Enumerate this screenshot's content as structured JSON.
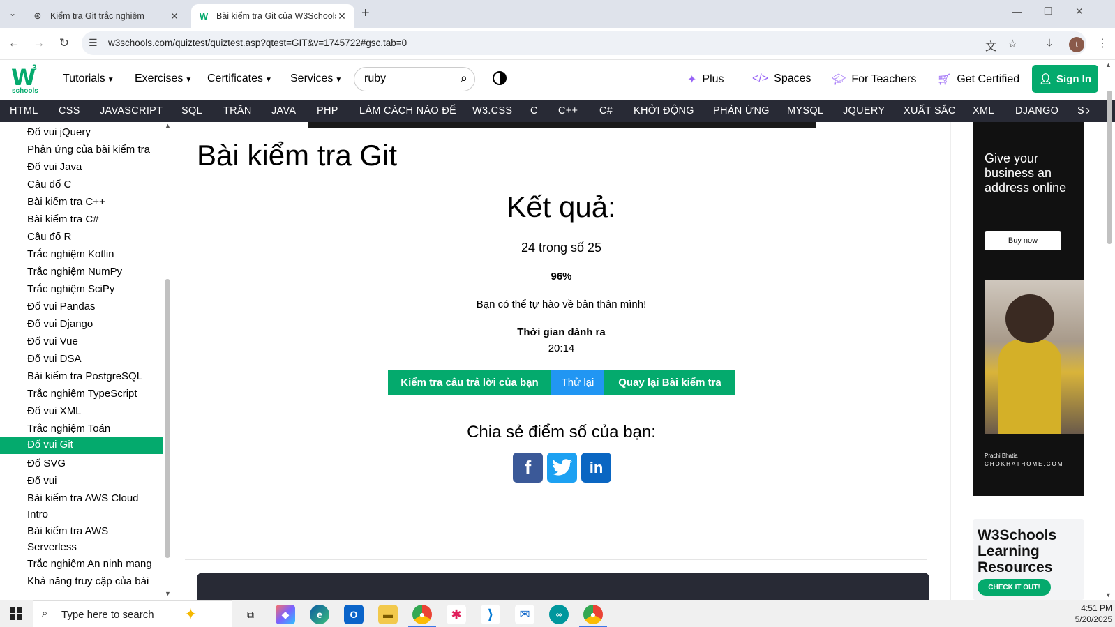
{
  "browser": {
    "tabs": [
      {
        "title": "Kiểm tra Git trắc nghiệm",
        "active": false
      },
      {
        "title": "Bài kiểm tra Git của W3Schools",
        "active": true
      }
    ],
    "url": "w3schools.com/quiztest/quiztest.asp?qtest=GIT&v=1745722#gsc.tab=0",
    "profile_initial": "t"
  },
  "w3nav": {
    "logo_mark": "W",
    "logo_sup": "3",
    "logo_text": "schools",
    "menus": [
      "Tutorials",
      "Exercises",
      "Certificates",
      "Services"
    ],
    "search_value": "ruby",
    "right_links": [
      "Plus",
      "Spaces",
      "For Teachers",
      "Get Certified"
    ],
    "signin": "Sign In"
  },
  "subnav": [
    "HTML",
    "CSS",
    "JAVASCRIPT",
    "SQL",
    "TRĂN",
    "JAVA",
    "PHP",
    "LÀM CÁCH NÀO ĐỂ",
    "W3.CSS",
    "C",
    "C++",
    "C#",
    "KHỞI ĐỘNG",
    "PHẢN ỨNG",
    "MYSQL",
    "JQUERY",
    "XUẤT SẮC",
    "XML",
    "DJANGO",
    "S"
  ],
  "sidebar": {
    "items": [
      "Đố vui jQuery",
      "Phản ứng của bài kiểm tra",
      "Đố vui Java",
      "Câu đố C",
      "Bài kiểm tra C++",
      "Bài kiểm tra C#",
      "Câu đố R",
      "Trắc nghiệm Kotlin",
      "Trắc nghiệm NumPy",
      "Trắc nghiệm SciPy",
      "Đố vui Pandas",
      "Đố vui Django",
      "Đố vui Vue",
      "Đố vui DSA",
      "Bài kiểm tra PostgreSQL",
      "Trắc nghiệm TypeScript",
      "Đố vui XML",
      "Trắc nghiệm Toán",
      "Đố vui Git",
      "Đố SVG",
      "Đố vui",
      "Bài kiểm tra AWS Cloud",
      "Intro",
      "Bài kiểm tra AWS",
      "Serverless",
      "Trắc nghiệm An ninh mạng",
      "Khả năng truy cập của bài"
    ],
    "active_index": 18
  },
  "main": {
    "title": "Bài kiểm tra Git",
    "result_heading": "Kết quả:",
    "score": "24 trong số 25",
    "percent": "96%",
    "message": "Bạn có thể tự hào về bản thân mình!",
    "time_label": "Thời gian dành ra",
    "time_value": "20:14",
    "buttons": {
      "check": "Kiểm tra câu trả lời của bạn",
      "retry": "Thử lại",
      "back": "Quay lại Bài kiểm tra"
    },
    "share_heading": "Chia sẻ điểm số của bạn:",
    "social": [
      "facebook-icon",
      "twitter-icon",
      "linkedin-icon"
    ]
  },
  "ads": {
    "headline": "Give your business an address online",
    "button": "Buy now",
    "caption_name": "Prachi Bhatia",
    "caption_site": "CHOKHATHOME.COM"
  },
  "resources": {
    "title": "W3Schools Learning Resources",
    "button": "CHECK IT OUT!"
  },
  "taskbar": {
    "search_placeholder": "Type here to search",
    "time": "4:51 PM",
    "date": "5/20/2025"
  },
  "colors": {
    "w3_green": "#04aa6d",
    "subnav_dark": "#282a35",
    "retry_blue": "#2196f3"
  }
}
